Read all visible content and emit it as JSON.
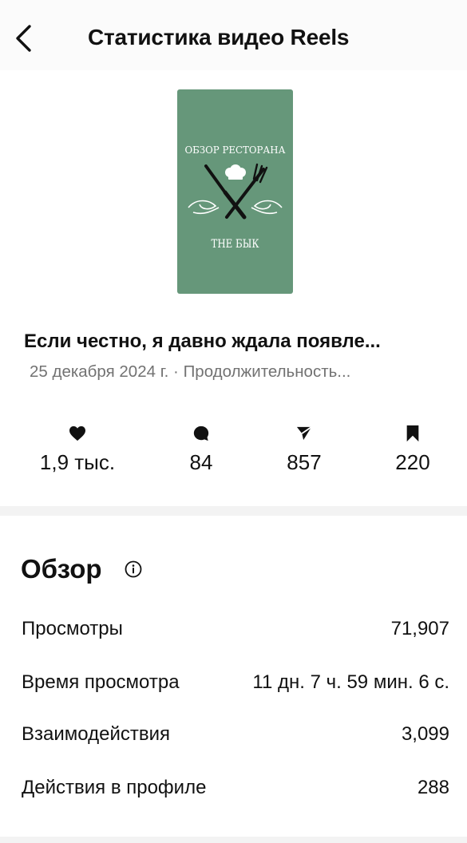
{
  "header": {
    "title": "Статистика видео Reels",
    "back_icon": "chevron-left-icon"
  },
  "reel": {
    "thumbnail_text_top": "ОБЗОР РЕСТОРАНА",
    "thumbnail_text_bottom": "THE БЫК",
    "thumbnail_color": "#66977a",
    "caption": "Если честно, я давно ждала появле...",
    "meta": "25 декабря 2024 г. · Продолжительность..."
  },
  "stats": [
    {
      "icon": "heart-icon",
      "value": "1,9 тыс."
    },
    {
      "icon": "comment-icon",
      "value": "84"
    },
    {
      "icon": "share-icon",
      "value": "857"
    },
    {
      "icon": "bookmark-icon",
      "value": "220"
    }
  ],
  "overview": {
    "title": "Обзор",
    "info_icon": "info-icon",
    "rows": [
      {
        "label": "Просмотры",
        "value": "71,907"
      },
      {
        "label": "Время просмотра",
        "value": "11 дн. 7 ч. 59 мин. 6 с."
      },
      {
        "label": "Взаимодействия",
        "value": "3,099"
      },
      {
        "label": "Действия в профиле",
        "value": "288"
      }
    ]
  }
}
